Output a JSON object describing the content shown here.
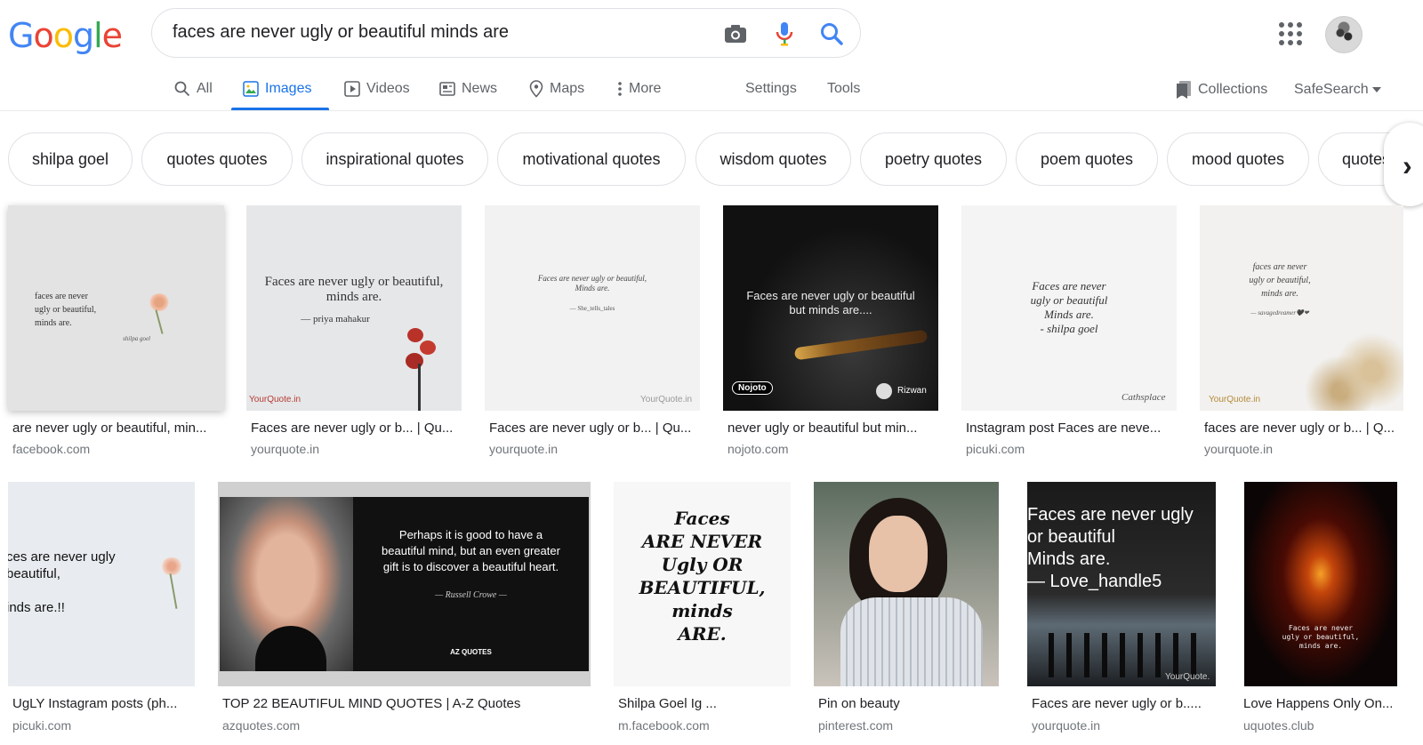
{
  "logo": {
    "letters": [
      "G",
      "o",
      "o",
      "g",
      "l",
      "e"
    ],
    "colors": [
      "#4285f4",
      "#ea4335",
      "#fbbc05",
      "#4285f4",
      "#34a853",
      "#ea4335"
    ]
  },
  "search": {
    "query": "faces are never ugly or beautiful minds are"
  },
  "tabs": [
    {
      "label": "All",
      "icon": "search-icon"
    },
    {
      "label": "Images",
      "icon": "image-icon"
    },
    {
      "label": "Videos",
      "icon": "video-icon"
    },
    {
      "label": "News",
      "icon": "news-icon"
    },
    {
      "label": "Maps",
      "icon": "map-pin-icon"
    },
    {
      "label": "More",
      "icon": "more-vert-icon"
    },
    {
      "label": "Settings"
    },
    {
      "label": "Tools"
    }
  ],
  "right_nav": {
    "collections": "Collections",
    "safesearch": "SafeSearch"
  },
  "chips": [
    "shilpa goel",
    "quotes quotes",
    "inspirational quotes",
    "motivational quotes",
    "wisdom quotes",
    "poetry quotes",
    "poem quotes",
    "mood quotes",
    "quotes"
  ],
  "results": [
    {
      "title": "are never ugly or beautiful, min...",
      "site": "facebook.com",
      "quote": "faces are never\nugly or beautiful,\nminds are.",
      "sig": "shilpa goel"
    },
    {
      "title": "Faces are never ugly or b... | Qu...",
      "site": "yourquote.in",
      "quote": "Faces are never ugly or beautiful,\nminds are.",
      "sig": "— priya mahakur",
      "brand": "YourQuote.in"
    },
    {
      "title": "Faces are never ugly or b... | Qu...",
      "site": "yourquote.in",
      "quote": "Faces are never ugly or beautiful,\nMinds are.",
      "sig": "— She_tells_tales",
      "brand": "YourQuote.in"
    },
    {
      "title": "never ugly or beautiful but min...",
      "site": "nojoto.com",
      "quote": "Faces are never ugly or beautiful\nbut minds are....",
      "brand": "Nojoto",
      "author": "Rizwan"
    },
    {
      "title": "Instagram post Faces are neve...",
      "site": "picuki.com",
      "quote": "Faces are never\nugly or beautiful\nMinds are.\n- shilpa goel",
      "sig": "Cathsplace"
    },
    {
      "title": "faces are never ugly or b... | Q...",
      "site": "yourquote.in",
      "quote": "faces are never\nugly or beautiful,\nminds are.",
      "sig": "— savagedreamer🖤❤",
      "brand": "YourQuote.in"
    },
    {
      "title": "UgLY Instagram posts (ph...",
      "site": "picuki.com",
      "quote": "ces are never ugly\nbeautiful,\n\ninds are.!!"
    },
    {
      "title": "TOP 22 BEAUTIFUL MIND QUOTES | A-Z Quotes",
      "site": "azquotes.com",
      "quote": "Perhaps it is good to have a\nbeautiful mind, but an even greater\ngift is to discover a beautiful heart.",
      "sig": "— Russell Crowe —",
      "brand": "AZ QUOTES"
    },
    {
      "title": "Shilpa Goel Ig ...",
      "site": "m.facebook.com",
      "quote": "Faces\nARE NEVER\nUgly OR\nBEAUTIFUL,\nminds\nARE."
    },
    {
      "title": "Pin on beauty",
      "site": "pinterest.com"
    },
    {
      "title": "Faces are never ugly or b.....",
      "site": "yourquote.in",
      "quote": "Faces are never ugly\nor beautiful\nMinds are.\n— Love_handle5",
      "brand": "YourQuote."
    },
    {
      "title": "Love Happens Only On...",
      "site": "uquotes.club",
      "quote": "Faces are never\nugly or beautiful,\nminds are."
    }
  ]
}
